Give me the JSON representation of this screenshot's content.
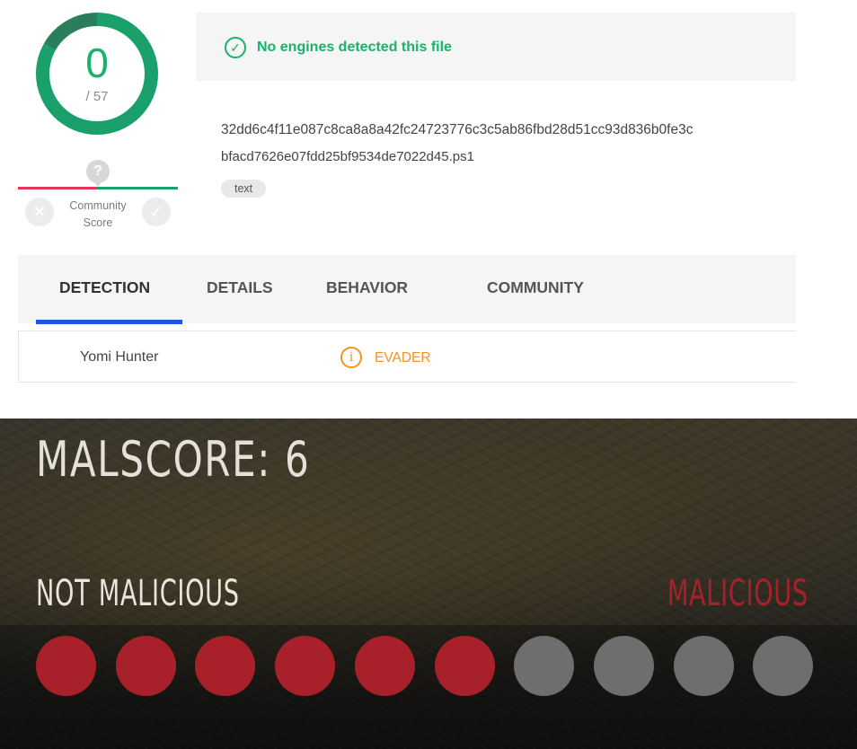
{
  "virustotal": {
    "detections": "0",
    "total_engines": "/ 57",
    "community_score_label": "Community Score",
    "community_pin": "?",
    "status_message": "No engines detected this file",
    "hash": "32dd6c4f11e087c8ca8a8a42fc24723776c3c5ab86fbd28d51cc93d836b0fe3c",
    "filename": "bfacd7626e07fdd25bf9534de7022d45.ps1",
    "tag": "text",
    "tabs": [
      {
        "label": "DETECTION"
      },
      {
        "label": "DETAILS"
      },
      {
        "label": "BEHAVIOR"
      },
      {
        "label": "COMMUNITY"
      }
    ],
    "active_tab": "DETECTION",
    "engine_row": {
      "engine": "Yomi Hunter",
      "verdict": "EVADER"
    },
    "colors": {
      "clean": "#18b26b",
      "warning": "#f7931e",
      "tab_active": "#1f55e6",
      "negative": "#e2365b"
    }
  },
  "malscore": {
    "title": "MALSCORE: 6",
    "score": 6,
    "max": 10,
    "label_low": "NOT MALICIOUS",
    "label_high": "MALICIOUS",
    "colors": {
      "filled": "#a8212a",
      "empty": "#6e6e6e"
    }
  }
}
